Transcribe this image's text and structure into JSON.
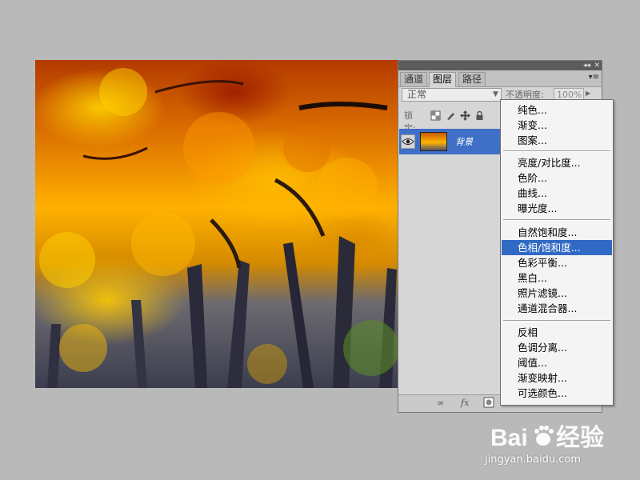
{
  "panel": {
    "tabs": [
      {
        "label": "通道"
      },
      {
        "label": "图层"
      },
      {
        "label": "路径"
      }
    ],
    "active_tab": "图层",
    "blend_mode": "正常",
    "opacity_label": "不透明度:",
    "opacity_value": "100%",
    "lock_label": "锁定:",
    "layer": {
      "name": "背景"
    }
  },
  "menu": {
    "items": [
      {
        "label": "纯色..."
      },
      {
        "label": "渐变..."
      },
      {
        "label": "图案..."
      },
      {
        "label": "亮度/对比度..."
      },
      {
        "label": "色阶..."
      },
      {
        "label": "曲线..."
      },
      {
        "label": "曝光度..."
      },
      {
        "label": "自然饱和度..."
      },
      {
        "label": "色相/饱和度..."
      },
      {
        "label": "色彩平衡..."
      },
      {
        "label": "黑白..."
      },
      {
        "label": "照片滤镜..."
      },
      {
        "label": "通道混合器..."
      },
      {
        "label": "反相"
      },
      {
        "label": "色调分离..."
      },
      {
        "label": "阈值..."
      },
      {
        "label": "渐变映射..."
      },
      {
        "label": "可选颜色..."
      }
    ],
    "selected_label": "色相/饱和度..."
  },
  "icons": {
    "eye": "eye-icon",
    "link": "link-layers-icon",
    "fx": "layer-style-fx-icon",
    "mask": "layer-mask-icon",
    "lock_transparent": "lock-transparent-pixels-icon",
    "lock_brush": "lock-image-pixels-icon",
    "lock_move": "lock-position-icon",
    "lock_all": "lock-all-icon",
    "panel_menu": "panel-menu-icon",
    "collapse": "collapse-panel-icon"
  },
  "watermark": {
    "logo": "Bai du 经验",
    "url": "jingyan.baidu.com"
  },
  "colors": {
    "selection": "#316ac5",
    "layer_highlight": "#3f6fc6",
    "background": "#b9b9b9"
  }
}
